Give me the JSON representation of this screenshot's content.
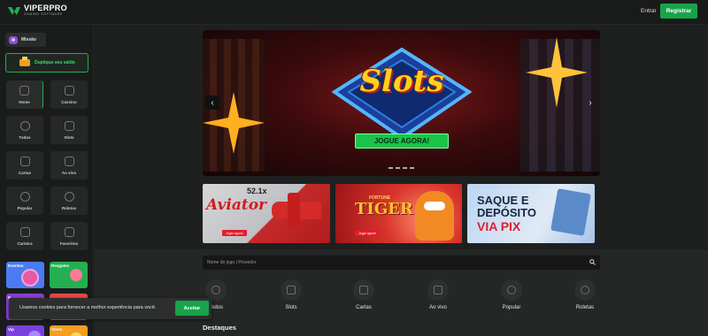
{
  "header": {
    "logo_main": "VIPERPRO",
    "logo_sub": "GAMING SOFTWARE",
    "login_label": "Entrar",
    "register_label": "Registrar"
  },
  "sidebar": {
    "mission_label": "Missão",
    "double_balance_label": "Duplique seu saldo",
    "nav_items": [
      {
        "label": "Home",
        "icon": "home-icon"
      },
      {
        "label": "Cassino",
        "icon": "casino-icon"
      },
      {
        "label": "Todos",
        "icon": "rocket-icon"
      },
      {
        "label": "Slots",
        "icon": "slot-machine-icon"
      },
      {
        "label": "Cartas",
        "icon": "cards-icon"
      },
      {
        "label": "Ao vivo",
        "icon": "live-icon"
      },
      {
        "label": "Popular",
        "icon": "fire-icon"
      },
      {
        "label": "Roletas",
        "icon": "roulette-icon"
      },
      {
        "label": "Carteira",
        "icon": "wallet-icon"
      },
      {
        "label": "Favoritos",
        "icon": "folder-icon"
      }
    ],
    "promos": [
      {
        "label": "Eventos",
        "color": "#4b7bf3"
      },
      {
        "label": "Resgates",
        "color": "#22b050"
      },
      {
        "label": "P",
        "color": "#8a3fd6"
      },
      {
        "label": "",
        "color": "#e84848"
      },
      {
        "label": "Vip",
        "color": "#7c3fe0"
      },
      {
        "label": "Sitem",
        "color": "#f59e20"
      }
    ]
  },
  "hero": {
    "title": "Slots",
    "cta": "JOGUE AGORA!",
    "prev_icon": "chevron-left-icon",
    "next_icon": "chevron-right-icon"
  },
  "banners": {
    "aviator": {
      "title": "Aviator",
      "multiplier": "52.1x",
      "button": "Jogar agora!"
    },
    "tiger": {
      "title": "TIGER",
      "sup": "FORTUNE",
      "button": "Jogar agora!"
    },
    "pix": {
      "line1": "SAQUE E",
      "line2": "DEPÓSITO",
      "line3": "VIA PIX"
    }
  },
  "search": {
    "placeholder": "Nome do jogo | Provedor",
    "icon": "search-icon"
  },
  "categories": [
    {
      "label": "Todos",
      "icon": "rocket-icon"
    },
    {
      "label": "Slots",
      "icon": "slot-machine-icon"
    },
    {
      "label": "Cartas",
      "icon": "cards-icon"
    },
    {
      "label": "Ao vivo",
      "icon": "live-icon"
    },
    {
      "label": "Popular",
      "icon": "fire-icon"
    },
    {
      "label": "Roletas",
      "icon": "roulette-icon"
    }
  ],
  "section_title": "Destaques",
  "cookie": {
    "text": "Usamos cookies para fornecer a melhor experiência para você.",
    "accept_label": "Aceitar"
  },
  "colors": {
    "accent": "#18a34a",
    "background": "#1c1e1d",
    "tile": "#252827"
  }
}
